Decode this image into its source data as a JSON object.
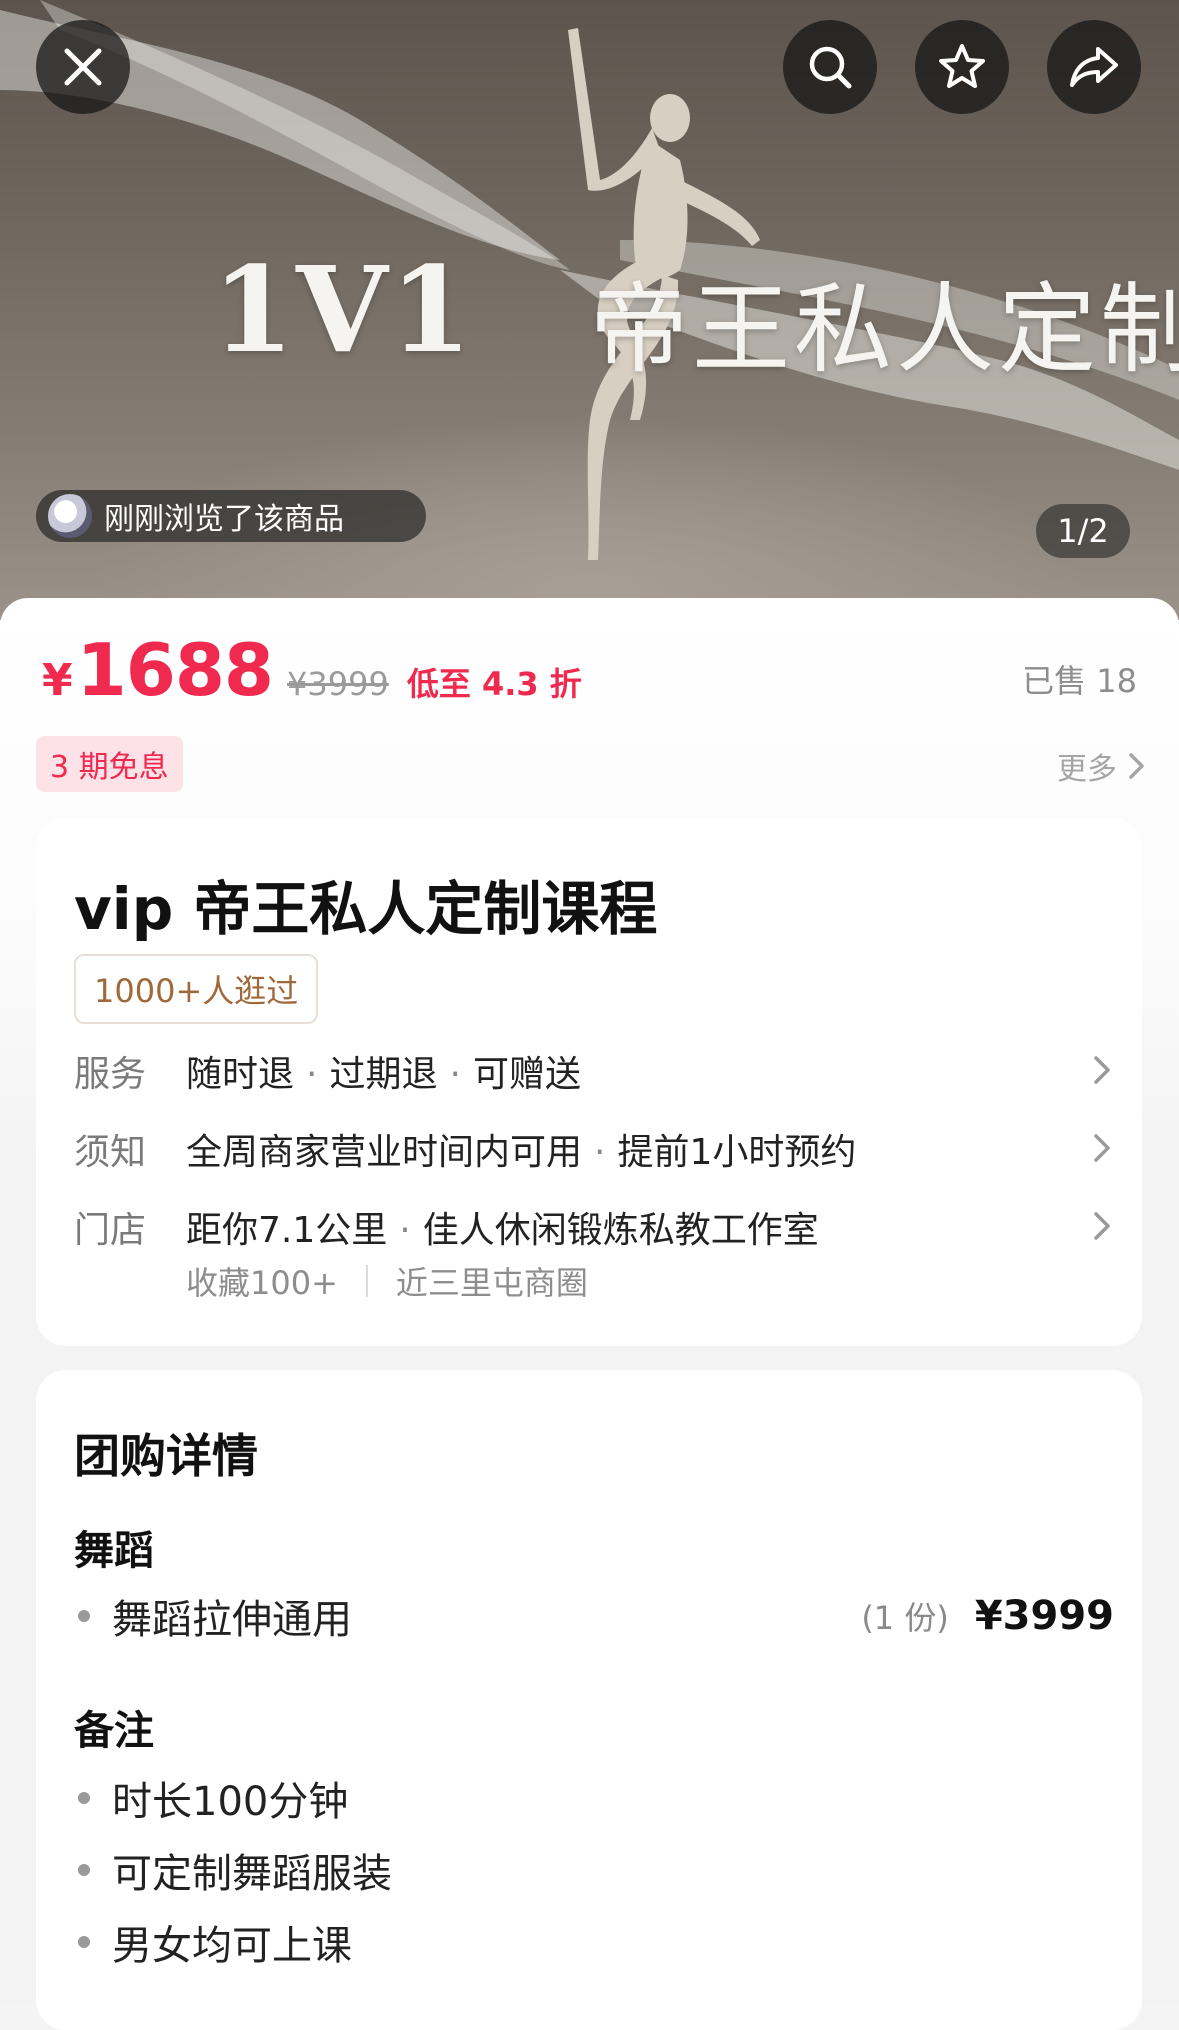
{
  "hero": {
    "headline_left": "1V1",
    "headline_right": "帝王私人定制",
    "viewer_text": "刚刚浏览了该商品",
    "page_indicator": "1/2"
  },
  "top_bar": {
    "close_icon": "close-icon",
    "search_icon": "search-icon",
    "favorite_icon": "star-icon",
    "share_icon": "share-icon"
  },
  "pricing": {
    "currency": "¥",
    "price": "1688",
    "original_price": "¥3999",
    "discount": "低至 4.3 折",
    "sold": "已售 18",
    "installment": "3 期免息",
    "more": "更多"
  },
  "product": {
    "title": "vip 帝王私人定制课程",
    "visited_tag": "1000+人逛过",
    "service": {
      "label": "服务",
      "items": [
        "随时退",
        "过期退",
        "可赠送"
      ]
    },
    "notice": {
      "label": "须知",
      "items": [
        "全周商家营业时间内可用",
        "提前1小时预约"
      ]
    },
    "store": {
      "label": "门店",
      "items": [
        "距你7.1公里",
        "佳人休闲锻炼私教工作室"
      ],
      "favorites": "收藏100+",
      "area": "近三里屯商圈"
    }
  },
  "details": {
    "title": "团购详情",
    "dance_section": "舞蹈",
    "dance_item": "舞蹈拉伸通用",
    "dance_qty": "(1 份)",
    "dance_price": "¥3999",
    "notes_section": "备注",
    "notes": [
      "时长100分钟",
      "可定制舞蹈服装",
      "男女均可上课"
    ]
  },
  "colors": {
    "accent": "#f0294f",
    "tag_text": "#a0693c",
    "muted": "#8d8d8d"
  }
}
